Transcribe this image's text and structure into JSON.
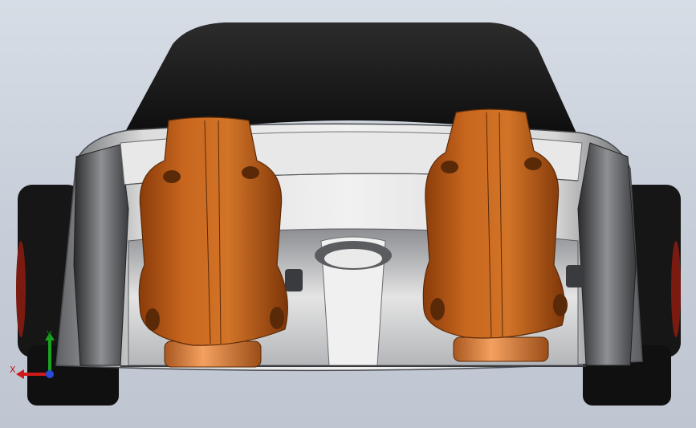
{
  "viewport": {
    "background": "#ccd2dc",
    "body_color": "#9ea0a3",
    "roof_color": "#151515",
    "seat_color": "#c0601a",
    "seat_base_color": "#e08840",
    "tire_color": "#121212"
  },
  "triad": {
    "x_label": "X",
    "y_label": "Y",
    "x_color": "#d01a1a",
    "y_color": "#19a11f",
    "z_color": "#2a4ad8"
  }
}
